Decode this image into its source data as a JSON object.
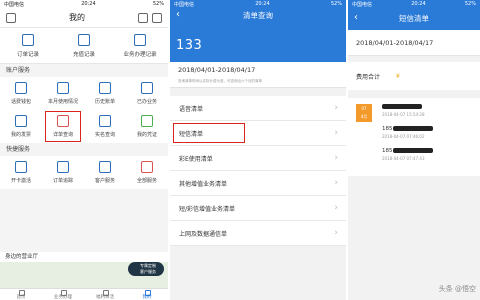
{
  "status": {
    "carrier": "中国电信",
    "time": "20:24",
    "battery": "52%"
  },
  "screen1": {
    "title": "我的",
    "row_top": [
      {
        "label": "订单记录",
        "icon": "clipboard-icon"
      },
      {
        "label": "充值记录",
        "icon": "receipt-icon"
      },
      {
        "label": "业务办理记录",
        "icon": "document-icon"
      }
    ],
    "section_account": "账户服务",
    "account_items": [
      {
        "label": "话费钱包",
        "icon": "wallet-icon"
      },
      {
        "label": "本月使用情况",
        "icon": "usage-icon"
      },
      {
        "label": "历史账单",
        "icon": "bill-icon"
      },
      {
        "label": "已办业务",
        "icon": "list-icon"
      },
      {
        "label": "我的发票",
        "icon": "invoice-icon"
      },
      {
        "label": "详单查询",
        "icon": "detail-query-icon"
      },
      {
        "label": "实名查询",
        "icon": "id-card-icon"
      },
      {
        "label": "我的凭证",
        "icon": "voucher-icon"
      }
    ],
    "section_quick": "快捷服务",
    "quick_items": [
      {
        "label": "开卡激活",
        "icon": "sim-card-icon"
      },
      {
        "label": "订单追踪",
        "icon": "truck-icon"
      },
      {
        "label": "客户服务",
        "icon": "headset-icon"
      },
      {
        "label": "全部服务",
        "icon": "grid-icon"
      }
    ],
    "nearby_title": "身边的营业厅",
    "service_badge": [
      "专属定制",
      "客户服务"
    ],
    "tabs": [
      "首页",
      "业务办理",
      "福利日活",
      "我的"
    ],
    "active_tab": "我的"
  },
  "screen2": {
    "title": "清单查询",
    "phone_visible": "133",
    "date_range": "2018/04/01-2018/04/17",
    "date_note": "查询清单时间以实际计费为准，可查询近六个月的清单",
    "items": [
      "语音清单",
      "短信清单",
      "彩E使用清单",
      "其他增值业务清单",
      "短/彩信增值业务清单",
      "上网及数据通信单"
    ],
    "highlighted": "短信清单"
  },
  "screen3": {
    "title": "短信清单",
    "date_range": "2018/04/01-2018/04/17",
    "fee_label": "费用合计",
    "fee_value": "¥",
    "day_badge": {
      "day": "07",
      "month": "4月"
    },
    "records": [
      {
        "prefix": "",
        "time": "2018-04-07 15:54:28"
      },
      {
        "prefix": "185",
        "time": "2018-04-07 07:46:02"
      },
      {
        "prefix": "185",
        "time": "2018-04-07 07:47:43"
      }
    ]
  },
  "watermark": "头条 @悟空",
  "colors": {
    "brand_blue": "#2a7ad8",
    "highlight_red": "#d9261c",
    "badge_orange": "#f39a2b"
  }
}
